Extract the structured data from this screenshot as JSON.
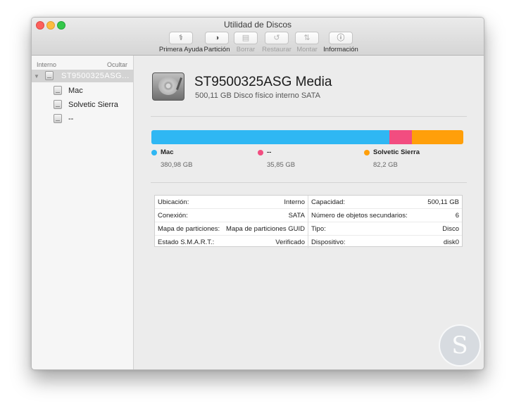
{
  "window": {
    "title": "Utilidad de Discos"
  },
  "toolbar": {
    "items": [
      {
        "label": "Primera Ayuda",
        "icon": "stethoscope-icon",
        "glyph": "⚕",
        "enabled": true
      },
      {
        "label": "Partición",
        "icon": "partition-icon",
        "glyph": "◑",
        "enabled": true
      },
      {
        "label": "Borrar",
        "icon": "erase-icon",
        "glyph": "▤",
        "enabled": false
      },
      {
        "label": "Restaurar",
        "icon": "restore-icon",
        "glyph": "↺",
        "enabled": false
      },
      {
        "label": "Montar",
        "icon": "mount-icon",
        "glyph": "⇅",
        "enabled": false
      },
      {
        "label": "Información",
        "icon": "info-icon",
        "glyph": "ⓘ",
        "enabled": true
      }
    ]
  },
  "sidebar": {
    "section_label": "Interno",
    "hide_label": "Ocultar",
    "disk": {
      "name": "ST9500325ASG..."
    },
    "volumes": [
      {
        "name": "Mac"
      },
      {
        "name": "Solvetic Sierra"
      },
      {
        "name": "--"
      }
    ]
  },
  "detail": {
    "title": "ST9500325ASG Media",
    "subtitle": "500,11 GB Disco físico interno SATA"
  },
  "usage": {
    "segments": [
      {
        "name": "Mac",
        "size": "380,98 GB",
        "gb": 380.98,
        "color": "#2fb7f3"
      },
      {
        "name": "--",
        "size": "35,85 GB",
        "gb": 35.85,
        "color": "#f24d80"
      },
      {
        "name": "Solvetic Sierra",
        "size": "82,2 GB",
        "gb": 82.2,
        "color": "#ff9f0a"
      }
    ]
  },
  "info": {
    "left": [
      {
        "key": "Ubicación:",
        "value": "Interno"
      },
      {
        "key": "Conexión:",
        "value": "SATA"
      },
      {
        "key": "Mapa de particiones:",
        "value": "Mapa de particiones GUID"
      },
      {
        "key": "Estado S.M.A.R.T.:",
        "value": "Verificado"
      }
    ],
    "right": [
      {
        "key": "Capacidad:",
        "value": "500,11 GB"
      },
      {
        "key": "Número de objetos secundarios:",
        "value": "6"
      },
      {
        "key": "Tipo:",
        "value": "Disco"
      },
      {
        "key": "Dispositivo:",
        "value": "disk0"
      }
    ]
  },
  "watermark": {
    "glyph": "S"
  }
}
